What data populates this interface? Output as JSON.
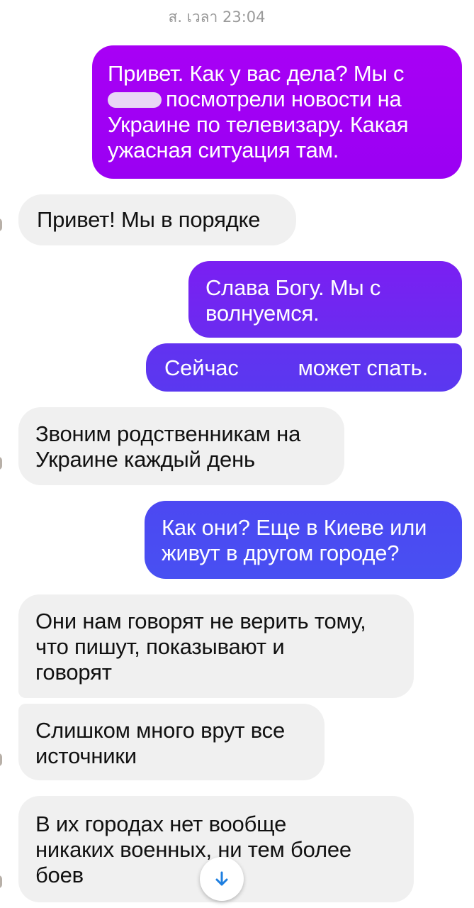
{
  "thread": {
    "timestamp": "ส. เวลา 23:04",
    "messages": [
      {
        "id": "m1",
        "direction": "out",
        "lines": [
          "Привет. Как у вас дела? Мы с",
          "посмотрели новости на",
          "Украине по телевизару. Какая",
          "ужасная ситуация там."
        ]
      },
      {
        "id": "m2",
        "direction": "in",
        "lines": [
          "Привет! Мы в порядке"
        ]
      },
      {
        "id": "m3",
        "direction": "out",
        "lines": [
          "Слава Богу. Мы с",
          "волнуемся."
        ]
      },
      {
        "id": "m4",
        "direction": "out",
        "lines": [
          "Сейчас",
          "может спать."
        ]
      },
      {
        "id": "m5",
        "direction": "in",
        "lines": [
          "Звоним родственникам на",
          "Украине каждый день"
        ]
      },
      {
        "id": "m6",
        "direction": "out",
        "lines": [
          "Как они? Еще в Киеве или",
          "живут в другом городе?"
        ]
      },
      {
        "id": "m7",
        "direction": "in",
        "lines": [
          "Они нам говорят не верить тому,",
          "что пишут, показывают и",
          "говорят"
        ]
      },
      {
        "id": "m8",
        "direction": "in",
        "lines": [
          "Слишком много врут все",
          "источники"
        ]
      },
      {
        "id": "m9",
        "direction": "in",
        "lines": [
          "В их городах нет вообще",
          "никаких военных, ни тем более",
          "боев"
        ]
      }
    ]
  },
  "colors": {
    "outgoing_top": "#a200f5",
    "outgoing_mid": "#6a30f0",
    "outgoing_bottom": "#4a4cf2",
    "incoming": "#f0f0f0",
    "scroll_arrow": "#1e7fe0"
  },
  "scroll_button": {
    "icon": "arrow-down-icon"
  }
}
